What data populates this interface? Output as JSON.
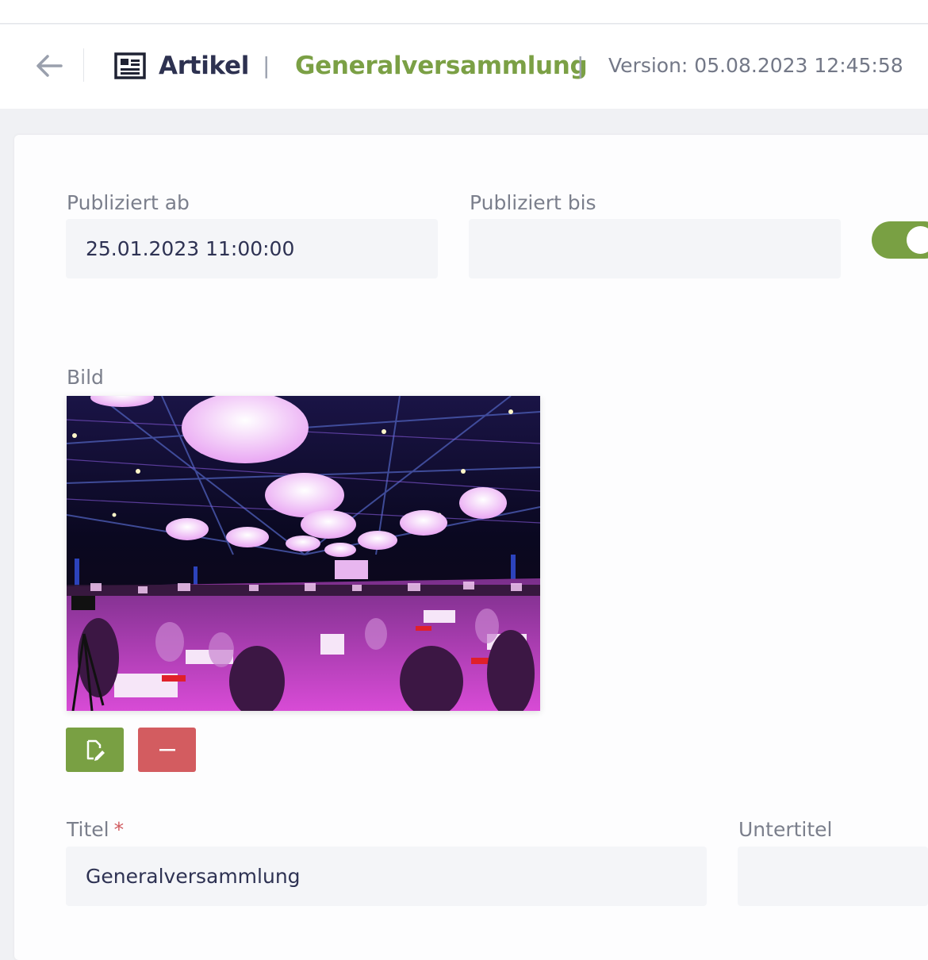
{
  "header": {
    "back_icon": "arrow-left-icon",
    "module_icon": "newspaper-icon",
    "module_title": "Artikel",
    "separator": "|",
    "record_title": "Generalversammlung",
    "version_text": "Version: 05.08.2023 12:45:58"
  },
  "form": {
    "published_from": {
      "label": "Publiziert ab",
      "value": "25.01.2023 11:00:00"
    },
    "published_until": {
      "label": "Publiziert bis",
      "value": ""
    },
    "active_toggle": {
      "on": true
    },
    "image": {
      "label": "Bild",
      "edit_icon": "edit-file-icon",
      "remove_icon": "minus-icon"
    },
    "title": {
      "label": "Titel",
      "required_mark": "*",
      "value": "Generalversammlung"
    },
    "subtitle": {
      "label": "Untertitel",
      "value": ""
    }
  },
  "colors": {
    "accent_green": "#79a043",
    "danger_red": "#d35c60",
    "text_dark": "#2d3150",
    "field_bg": "#f4f5f8"
  }
}
